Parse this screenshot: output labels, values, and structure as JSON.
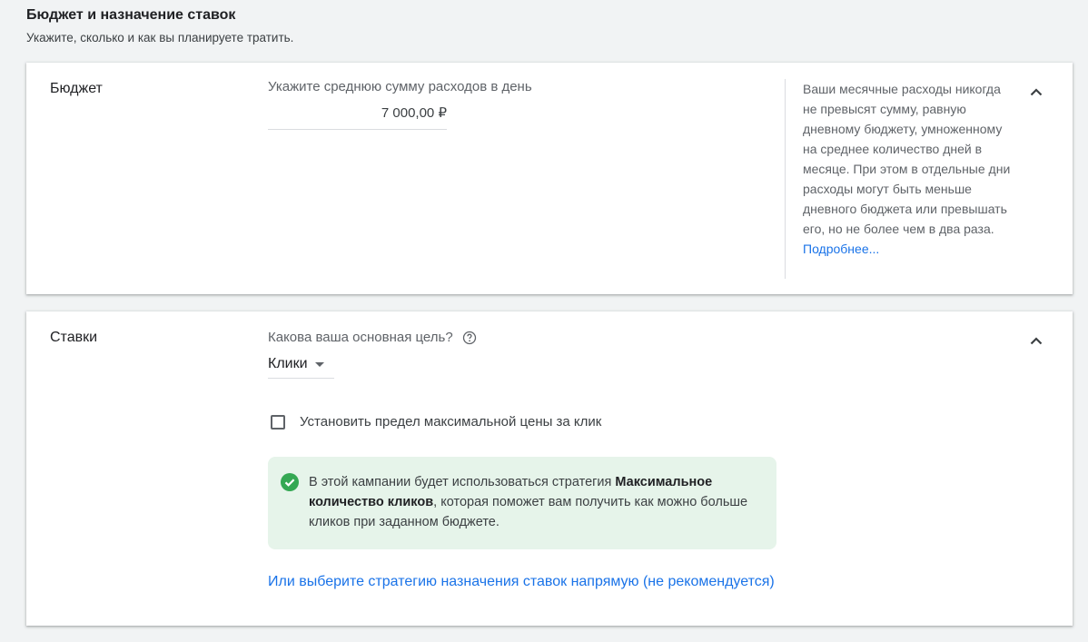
{
  "header": {
    "title": "Бюджет и назначение ставок",
    "subtitle": "Укажите, сколько и как вы планируете тратить."
  },
  "budget": {
    "title": "Бюджет",
    "field_label": "Укажите среднюю сумму расходов в день",
    "value": "7 000,00 ₽",
    "help_text": "Ваши месячные расходы никогда не превысят сумму, равную дневному бюджету, умноженному на среднее количество дней в месяце. При этом в отдельные дни расходы могут быть меньше дневного бюджета или превышать его, но не более чем в два раза.",
    "learn_more": "Подробнее..."
  },
  "bids": {
    "title": "Ставки",
    "goal_question": "Какова ваша основная цель?",
    "goal_value": "Клики",
    "max_cpc_label": "Установить предел максимальной цены за клик",
    "max_cpc_checked": false,
    "info_prefix": "В этой кампании будет использоваться стратегия ",
    "info_strategy": "Максимальное количество кликов",
    "info_suffix": ", которая поможет вам получить как можно больше кликов при заданном бюджете.",
    "direct_strategy_link": "Или выберите стратегию назначения ставок напрямую (не рекомендуется)"
  },
  "colors": {
    "accent": "#1a73e8",
    "success": "#34a853",
    "info_bg": "#e6f4ea"
  },
  "icons": {
    "collapse": "chevron-up-icon",
    "help": "help-circle-icon",
    "dropdown": "arrow-drop-down-icon",
    "success": "check-circle-icon"
  }
}
